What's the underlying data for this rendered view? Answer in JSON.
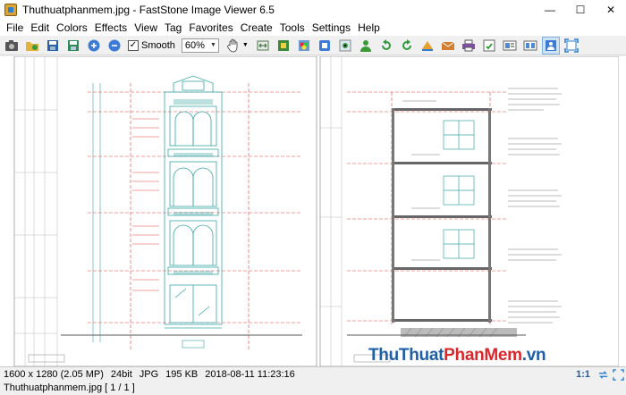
{
  "window": {
    "title": "Thuthuatphanmem.jpg  -  FastStone Image Viewer 6.5",
    "minimize_glyph": "—",
    "maximize_glyph": "☐",
    "close_glyph": "✕"
  },
  "menu": {
    "items": [
      "File",
      "Edit",
      "Colors",
      "Effects",
      "View",
      "Tag",
      "Favorites",
      "Create",
      "Tools",
      "Settings",
      "Help"
    ]
  },
  "toolbar": {
    "smooth_label": "Smooth",
    "smooth_checked": true,
    "check_glyph": "✓",
    "zoom_value": "60%",
    "dropdown_glyph": "▼",
    "buttons_left": [
      "camera-icon",
      "open-folder-icon",
      "save-icon",
      "save-as-icon",
      "zoom-in-icon",
      "zoom-out-icon"
    ],
    "buttons_right": [
      "resize-icon",
      "crop-icon",
      "color-adjust-icon",
      "clone-icon",
      "red-eye-icon",
      "user-icon",
      "rotate-left-icon",
      "rotate-right-icon",
      "flip-icon",
      "email-icon",
      "print-icon",
      "export-icon",
      "slideshow-icon",
      "compare-icon",
      "fullscreen-icon",
      "fit-window-icon"
    ]
  },
  "watermark": {
    "part1": "ThuThuat",
    "part2": "PhanMem",
    "part3": ".vn"
  },
  "status": {
    "dimensions": "1600 x 1280 (2.05 MP)",
    "bit_depth": "24bit",
    "format": "JPG",
    "size": "195 KB",
    "datetime": "2018-08-11 11:23:16",
    "ratio": "1:1"
  },
  "file": {
    "name_index": "Thuthuatphanmem.jpg [ 1 / 1 ]"
  },
  "colors": {
    "drawing_cyan": "#3aa6a6",
    "drawing_red": "#e04040",
    "drawing_gray": "#9a9a9a",
    "watermark_blue": "#1f5fa8",
    "watermark_red": "#d8282d"
  }
}
